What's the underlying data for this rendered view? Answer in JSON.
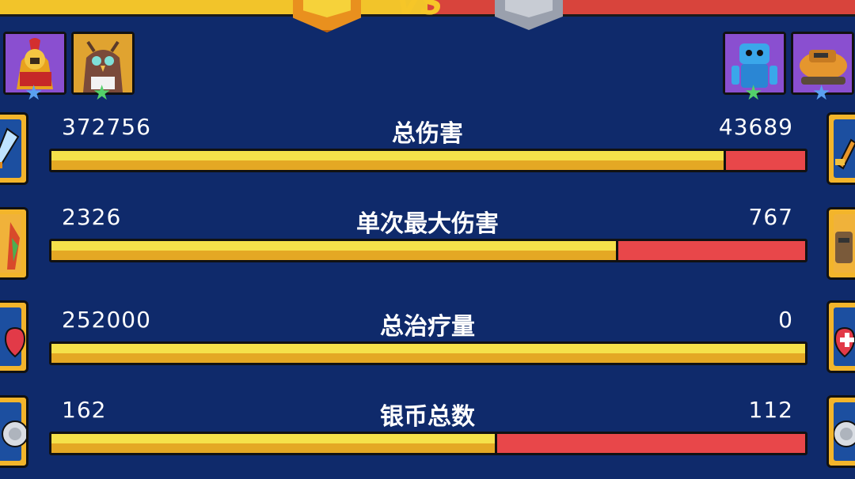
{
  "header": {
    "vs_text": "VS",
    "left_color": "#f2c42a",
    "right_color": "#d8443c"
  },
  "left_team": {
    "portraits": [
      {
        "name": "spartan-warrior-portrait",
        "star": "blue"
      },
      {
        "name": "owl-mage-portrait",
        "star": "green"
      }
    ]
  },
  "right_team": {
    "portraits": [
      {
        "name": "blue-robot-portrait",
        "star": "green"
      },
      {
        "name": "orange-tank-portrait",
        "star": "blue"
      }
    ]
  },
  "stats": [
    {
      "label": "总伤害",
      "left_value": "372756",
      "right_value": "43689",
      "left_fraction": 0.895,
      "left_icon": "sword-icon",
      "right_icon": "sword-icon"
    },
    {
      "label": "单次最大伤害",
      "left_value": "2326",
      "right_value": "767",
      "left_fraction": 0.752,
      "left_icon": "hero-avatar-icon",
      "right_icon": "enemy-avatar-icon"
    },
    {
      "label": "总治疗量",
      "left_value": "252000",
      "right_value": "0",
      "left_fraction": 1.0,
      "left_icon": "heart-icon",
      "right_icon": "heal-heart-icon"
    },
    {
      "label": "银币总数",
      "left_value": "162",
      "right_value": "112",
      "left_fraction": 0.591,
      "left_icon": "silver-coin-icon",
      "right_icon": "silver-coin-icon"
    }
  ],
  "colors": {
    "background": "#0f2a6b",
    "bar_left": "#f5e14a",
    "bar_right": "#e8474a"
  }
}
